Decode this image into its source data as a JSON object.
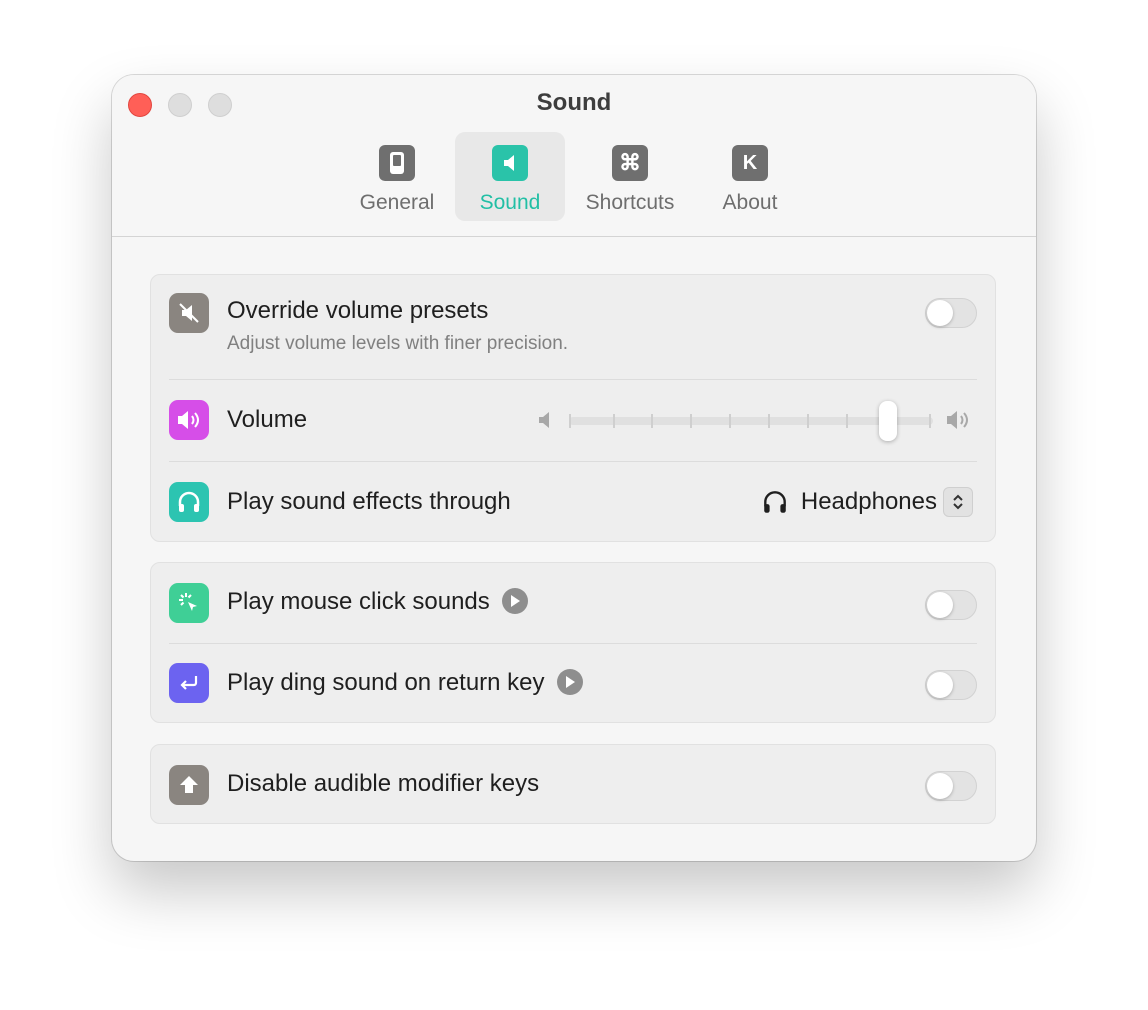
{
  "window": {
    "title": "Sound"
  },
  "tabs": [
    {
      "label": "General",
      "icon": "phone-icon"
    },
    {
      "label": "Sound",
      "icon": "speaker-icon",
      "selected": true
    },
    {
      "label": "Shortcuts",
      "icon": "command-icon",
      "glyph": "⌘"
    },
    {
      "label": "About",
      "icon": "k-logo-icon",
      "glyph": "K"
    }
  ],
  "sound_group": {
    "override": {
      "title": "Override volume presets",
      "subtitle": "Adjust volume levels with finer precision.",
      "enabled": false
    },
    "volume": {
      "title": "Volume",
      "level": 0.875
    },
    "output": {
      "title": "Play sound effects through",
      "value": "Headphones"
    }
  },
  "click_group": {
    "mouse": {
      "title": "Play mouse click sounds",
      "enabled": false
    },
    "ding": {
      "title": "Play ding sound on return key",
      "enabled": false
    }
  },
  "modifier_group": {
    "disable": {
      "title": "Disable audible modifier keys",
      "enabled": false
    }
  },
  "colors": {
    "accent": "#2ac3a9",
    "override_icon": "#8a8580",
    "volume_icon": "#d64ee8",
    "headphones_icon": "#2cc4b1",
    "mouse_icon": "#3fcf96",
    "ding_icon": "#6c63f0",
    "modifier_icon": "#8a8580"
  }
}
